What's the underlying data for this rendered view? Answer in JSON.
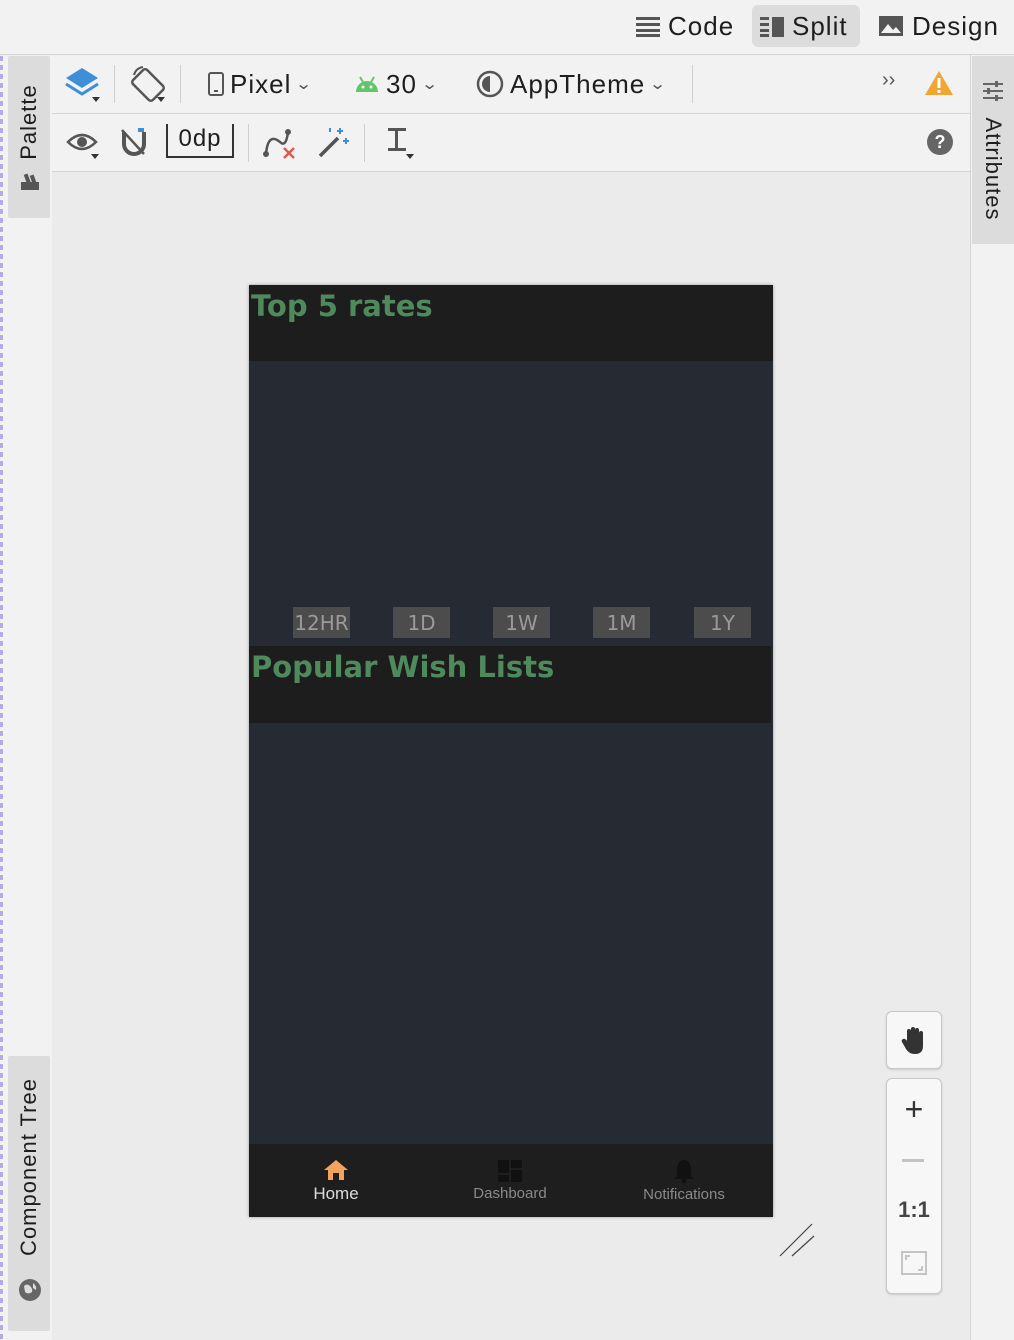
{
  "view_modes": {
    "code": "Code",
    "split": "Split",
    "design": "Design",
    "active": "Split"
  },
  "side_tabs": {
    "palette": "Palette",
    "component_tree": "Component Tree",
    "attributes": "Attributes"
  },
  "toolbar": {
    "device": "Pixel",
    "api_level": "30",
    "theme": "AppTheme",
    "margin": "0dp"
  },
  "preview": {
    "section1_title": "Top 5 rates",
    "timeframes": [
      "12HR",
      "1D",
      "1W",
      "1M",
      "1Y"
    ],
    "section2_title": "Popular Wish Lists",
    "nav": {
      "home": "Home",
      "dashboard": "Dashboard",
      "notifications": "Notifications",
      "active": "Home"
    }
  },
  "zoom": {
    "one_to_one": "1:1"
  },
  "colors": {
    "accent_green": "#4f8a5c",
    "nav_active": "#f4a35c",
    "warning": "#f0a732",
    "android_green": "#62c56a",
    "layer_blue": "#3f8ed8"
  }
}
